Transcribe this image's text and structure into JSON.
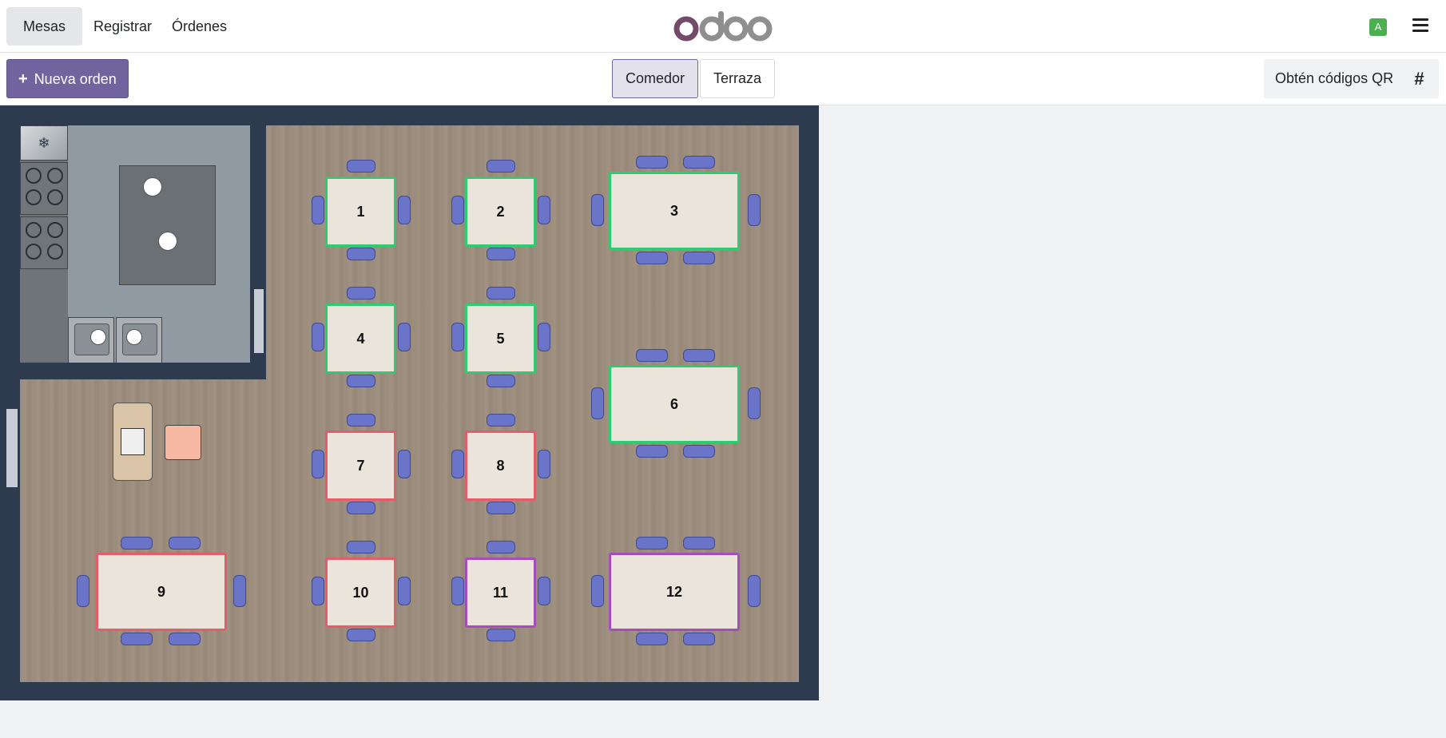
{
  "topbar": {
    "tabs": [
      {
        "label": "Mesas",
        "active": true
      },
      {
        "label": "Registrar",
        "active": false
      },
      {
        "label": "Órdenes",
        "active": false
      }
    ],
    "logo_text": "odoo",
    "avatar_initial": "A",
    "menu_icon": "hamburger-icon"
  },
  "subbar": {
    "new_order_label": "Nueva orden",
    "floors": [
      {
        "label": "Comedor",
        "active": true
      },
      {
        "label": "Terraza",
        "active": false
      }
    ],
    "qr_label": "Obtén códigos QR",
    "hash_label": "#"
  },
  "colors": {
    "primary": "#71639e",
    "free": "#2ecc71",
    "occupied": "#e35d6a",
    "ordered": "#a64dbd",
    "floor_wall": "#2e3b4e"
  },
  "tables": [
    {
      "name": "1",
      "status": "free"
    },
    {
      "name": "2",
      "status": "free"
    },
    {
      "name": "3",
      "status": "free"
    },
    {
      "name": "4",
      "status": "free"
    },
    {
      "name": "5",
      "status": "free"
    },
    {
      "name": "6",
      "status": "free"
    },
    {
      "name": "7",
      "status": "occupied"
    },
    {
      "name": "8",
      "status": "occupied"
    },
    {
      "name": "9",
      "status": "occupied"
    },
    {
      "name": "10",
      "status": "occupied"
    },
    {
      "name": "11",
      "status": "ordered"
    },
    {
      "name": "12",
      "status": "ordered"
    }
  ]
}
